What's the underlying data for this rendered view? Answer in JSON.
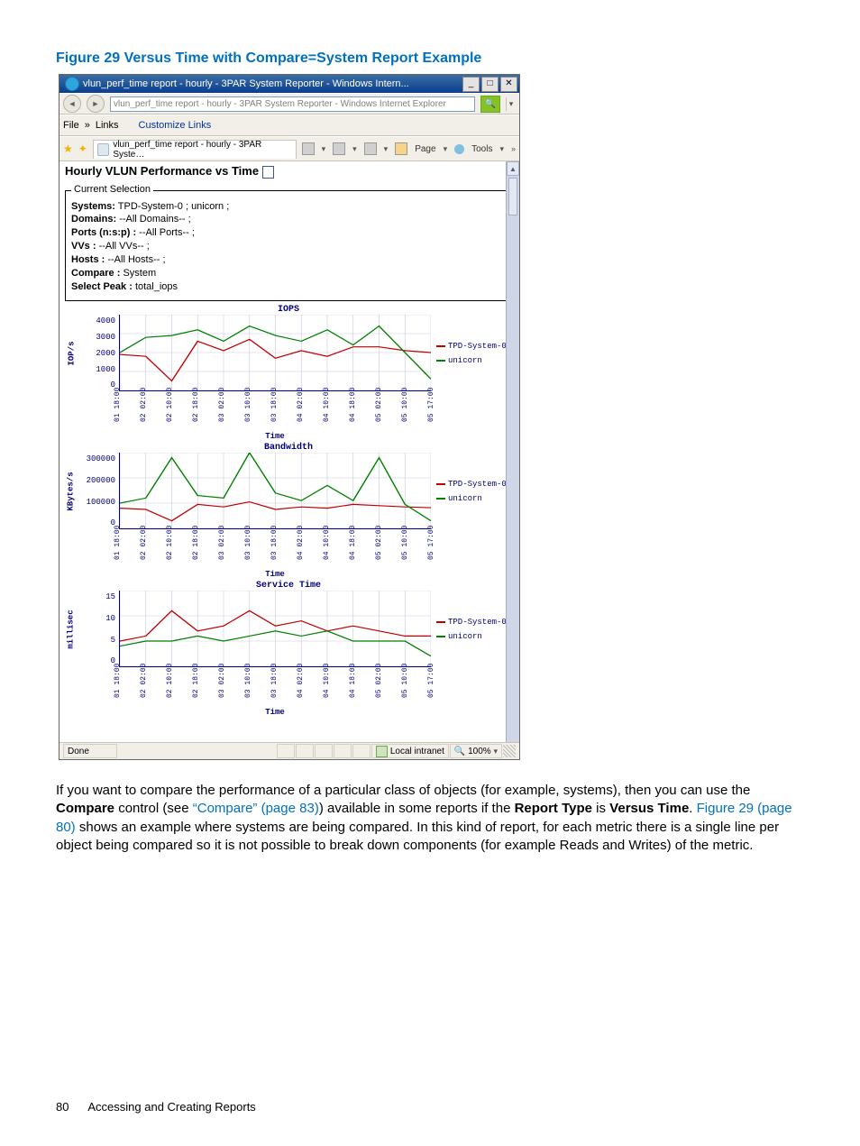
{
  "page": {
    "figure_title": "Figure 29 Versus Time with Compare=System Report Example",
    "footer_page": "80",
    "footer_section": "Accessing and Creating Reports"
  },
  "window": {
    "title": "vlun_perf_time report - hourly - 3PAR System Reporter - Windows Intern...",
    "address": "vlun_perf_time report - hourly - 3PAR System Reporter - Windows Internet Explorer",
    "menu": {
      "file": "File",
      "links_label": "Links",
      "customize": "Customize Links"
    },
    "tab": "vlun_perf_time report - hourly - 3PAR Syste…",
    "tools": {
      "page": "Page",
      "tools": "Tools"
    },
    "content_title": "Hourly VLUN Performance vs Time",
    "selection": {
      "legend": "Current Selection",
      "systems_label": "Systems:",
      "systems_val": "TPD-System-0 ; unicorn ;",
      "domains_label": "Domains:",
      "domains_val": "--All Domains-- ;",
      "ports_label": "Ports (n:s:p) :",
      "ports_val": "--All Ports-- ;",
      "vvs_label": "VVs :",
      "vvs_val": "--All VVs-- ;",
      "hosts_label": "Hosts :",
      "hosts_val": "--All Hosts-- ;",
      "compare_label": "Compare :",
      "compare_val": "System",
      "peak_label": "Select Peak :",
      "peak_val": "total_iops"
    },
    "status": {
      "done": "Done",
      "zone": "Local intranet",
      "zoom": "100%",
      "zoom_glyph": "🔍"
    }
  },
  "charts_common": {
    "xticks": [
      "01 18:00",
      "02 02:00",
      "02 10:00",
      "02 18:00",
      "03 02:00",
      "03 10:00",
      "03 18:00",
      "04 02:00",
      "04 10:00",
      "04 18:00",
      "05 02:00",
      "05 10:00",
      "05 17:00"
    ],
    "xlabel": "Time",
    "series_names": {
      "a": "TPD-System-0",
      "b": "unicorn"
    },
    "colors": {
      "a": "#c00000",
      "b": "#008000"
    }
  },
  "paragraph": {
    "t1": "If you want to compare the performance of a particular class of objects (for example, systems), then you can use the ",
    "b1": "Compare",
    "t2": " control (see ",
    "link1": "“Compare” (page 83)",
    "t3": ") available in some reports if the ",
    "b2": "Report Type",
    "t4": " is ",
    "b3": "Versus Time",
    "t5": ". ",
    "link2": "Figure 29 (page 80)",
    "t6": " shows an example where systems are being compared. In this kind of report, for each metric there is a single line per object being compared so it is not possible to break down components (for example Reads and Writes) of the metric."
  },
  "chart_data": [
    {
      "type": "line",
      "title": "IOPS",
      "ylabel": "IOP/s",
      "xlabel": "Time",
      "yticks": [
        0,
        1000,
        2000,
        3000,
        4000
      ],
      "ylim": [
        0,
        4000
      ],
      "categories": [
        "01 18:00",
        "02 02:00",
        "02 10:00",
        "02 18:00",
        "03 02:00",
        "03 10:00",
        "03 18:00",
        "04 02:00",
        "04 10:00",
        "04 18:00",
        "05 02:00",
        "05 10:00",
        "05 17:00"
      ],
      "series": [
        {
          "name": "TPD-System-0",
          "color": "#c00000",
          "values": [
            1900,
            1800,
            500,
            2600,
            2100,
            2700,
            1700,
            2100,
            1800,
            2300,
            2300,
            2100,
            2000
          ]
        },
        {
          "name": "unicorn",
          "color": "#008000",
          "values": [
            2000,
            2800,
            2900,
            3200,
            2600,
            3400,
            2900,
            2600,
            3200,
            2400,
            3400,
            2000,
            600
          ]
        }
      ]
    },
    {
      "type": "line",
      "title": "Bandwidth",
      "ylabel": "KBytes/s",
      "xlabel": "Time",
      "yticks": [
        0,
        100000,
        200000,
        300000
      ],
      "ylim": [
        0,
        300000
      ],
      "categories": [
        "01 18:00",
        "02 02:00",
        "02 10:00",
        "02 18:00",
        "03 02:00",
        "03 10:00",
        "03 18:00",
        "04 02:00",
        "04 10:00",
        "04 18:00",
        "05 02:00",
        "05 10:00",
        "05 17:00"
      ],
      "series": [
        {
          "name": "TPD-System-0",
          "color": "#c00000",
          "values": [
            80000,
            75000,
            30000,
            95000,
            85000,
            105000,
            75000,
            85000,
            80000,
            95000,
            90000,
            85000,
            82000
          ]
        },
        {
          "name": "unicorn",
          "color": "#008000",
          "values": [
            100000,
            120000,
            280000,
            130000,
            120000,
            300000,
            140000,
            110000,
            170000,
            110000,
            280000,
            95000,
            30000
          ]
        }
      ]
    },
    {
      "type": "line",
      "title": "Service Time",
      "ylabel": "millisec",
      "xlabel": "Time",
      "yticks": [
        0,
        5,
        10,
        15
      ],
      "ylim": [
        0,
        15
      ],
      "categories": [
        "01 18:00",
        "02 02:00",
        "02 10:00",
        "02 18:00",
        "03 02:00",
        "03 10:00",
        "03 18:00",
        "04 02:00",
        "04 10:00",
        "04 18:00",
        "05 02:00",
        "05 10:00",
        "05 17:00"
      ],
      "series": [
        {
          "name": "TPD-System-0",
          "color": "#c00000",
          "values": [
            5,
            6,
            11,
            7,
            8,
            11,
            8,
            9,
            7,
            8,
            7,
            6,
            6
          ]
        },
        {
          "name": "unicorn",
          "color": "#008000",
          "values": [
            4,
            5,
            5,
            6,
            5,
            6,
            7,
            6,
            7,
            5,
            5,
            5,
            2
          ]
        }
      ]
    }
  ]
}
